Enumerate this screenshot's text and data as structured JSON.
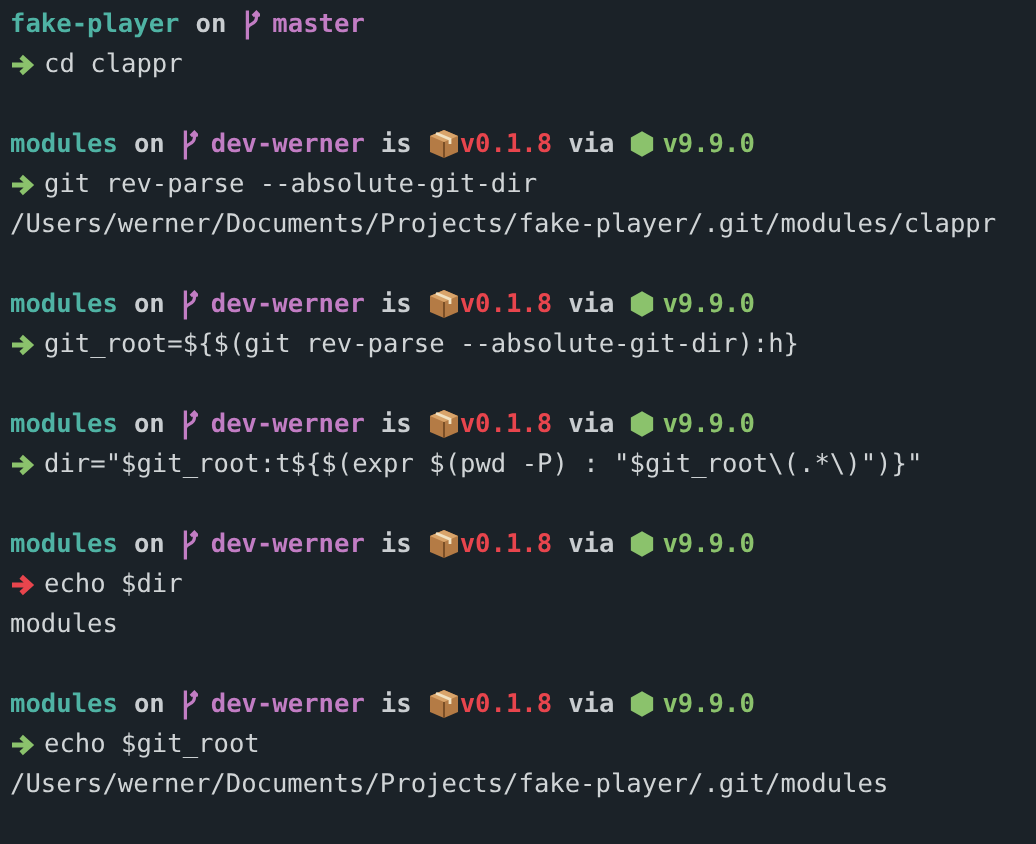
{
  "blocks": [
    {
      "prompt": {
        "directory": "fake-player",
        "on": "on",
        "branch": "master"
      },
      "command": {
        "failed": false,
        "text": "cd clappr"
      }
    },
    {
      "prompt": {
        "directory": "modules",
        "on": "on",
        "branch": "dev-werner",
        "is": "is",
        "package_version": "v0.1.8",
        "via": "via",
        "node_version": "v9.9.0"
      },
      "command": {
        "failed": false,
        "text": "git rev-parse --absolute-git-dir"
      },
      "output": [
        "/Users/werner/Documents/Projects/fake-player/.git/modules/clappr"
      ]
    },
    {
      "prompt": {
        "directory": "modules",
        "on": "on",
        "branch": "dev-werner",
        "is": "is",
        "package_version": "v0.1.8",
        "via": "via",
        "node_version": "v9.9.0"
      },
      "command": {
        "failed": false,
        "text": "git_root=${$(git rev-parse --absolute-git-dir):h}"
      }
    },
    {
      "prompt": {
        "directory": "modules",
        "on": "on",
        "branch": "dev-werner",
        "is": "is",
        "package_version": "v0.1.8",
        "via": "via",
        "node_version": "v9.9.0"
      },
      "command": {
        "failed": false,
        "text": "dir=\"$git_root:t${$(expr $(pwd -P) : \"$git_root\\(.*\\)\")}\""
      }
    },
    {
      "prompt": {
        "directory": "modules",
        "on": "on",
        "branch": "dev-werner",
        "is": "is",
        "package_version": "v0.1.8",
        "via": "via",
        "node_version": "v9.9.0"
      },
      "command": {
        "failed": true,
        "text": "echo $dir"
      },
      "output": [
        "modules"
      ]
    },
    {
      "prompt": {
        "directory": "modules",
        "on": "on",
        "branch": "dev-werner",
        "is": "is",
        "package_version": "v0.1.8",
        "via": "via",
        "node_version": "v9.9.0"
      },
      "command": {
        "failed": false,
        "text": "echo $git_root"
      },
      "output": [
        "/Users/werner/Documents/Projects/fake-player/.git/modules"
      ]
    }
  ]
}
